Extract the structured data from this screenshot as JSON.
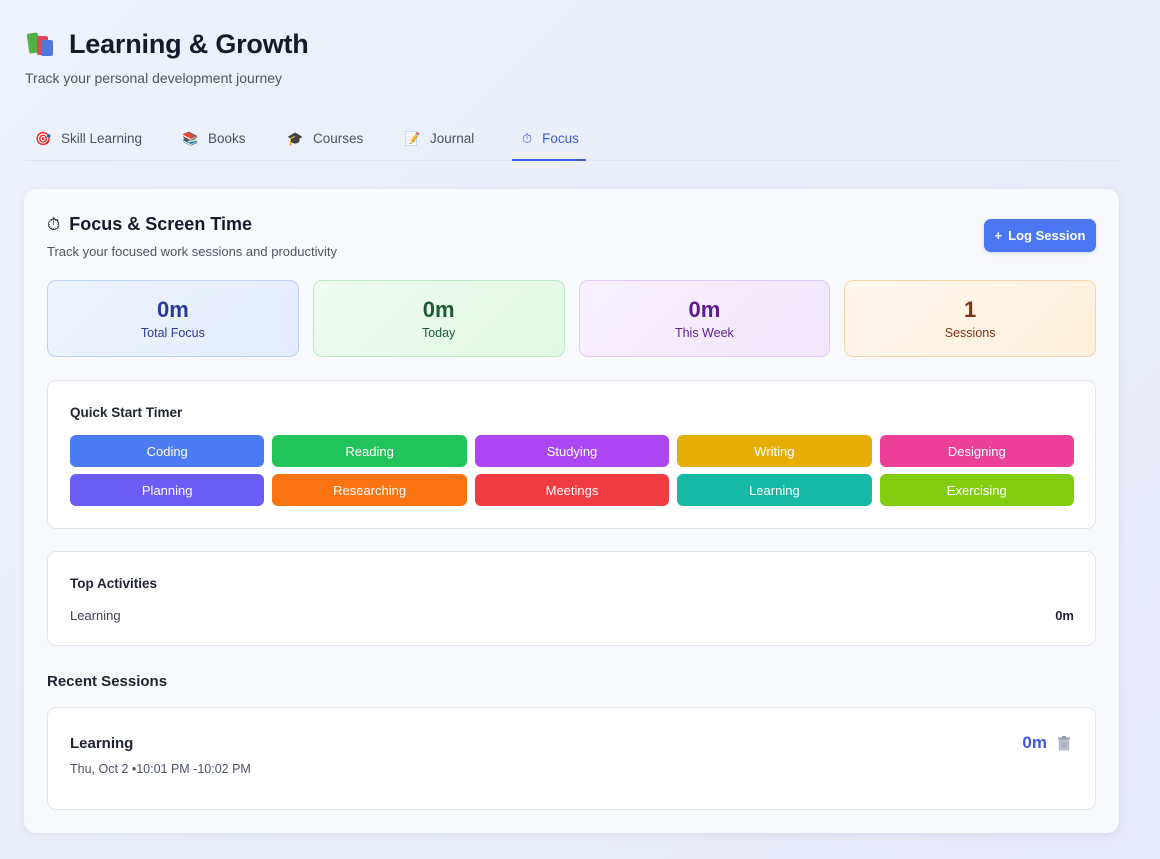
{
  "header": {
    "title": "Learning & Growth",
    "subtitle": "Track your personal development journey",
    "icon": "books-icon"
  },
  "tabs": [
    {
      "label": "Skill Learning",
      "icon": "🎯",
      "active": false
    },
    {
      "label": "Books",
      "icon": "📚",
      "active": false
    },
    {
      "label": "Courses",
      "icon": "🎓",
      "active": false
    },
    {
      "label": "Journal",
      "icon": "📝",
      "active": false
    },
    {
      "label": "Focus",
      "icon": "⏱",
      "active": true
    }
  ],
  "focus": {
    "title": "Focus & Screen Time",
    "title_icon": "⏱",
    "subtitle": "Track your focused work sessions and productivity",
    "log_button": "Log Session",
    "log_button_icon": "+"
  },
  "stats": [
    {
      "value": "0m",
      "label": "Total Focus",
      "color": "#2a3b95"
    },
    {
      "value": "0m",
      "label": "Today",
      "color": "#1d5c33"
    },
    {
      "value": "0m",
      "label": "This Week",
      "color": "#5c1a8c"
    },
    {
      "value": "1",
      "label": "Sessions",
      "color": "#7f3112"
    }
  ],
  "quick_start": {
    "title": "Quick Start Timer",
    "buttons": [
      {
        "label": "Coding",
        "color": "#4b7cf3"
      },
      {
        "label": "Reading",
        "color": "#21c45a"
      },
      {
        "label": "Studying",
        "color": "#ad47f5"
      },
      {
        "label": "Writing",
        "color": "#e6ad06"
      },
      {
        "label": "Designing",
        "color": "#ec3f97"
      },
      {
        "label": "Planning",
        "color": "#6a5cf4"
      },
      {
        "label": "Researching",
        "color": "#f97311"
      },
      {
        "label": "Meetings",
        "color": "#ef3b41"
      },
      {
        "label": "Learning",
        "color": "#16b9a4"
      },
      {
        "label": "Exercising",
        "color": "#82cc12"
      }
    ]
  },
  "top_activities": {
    "title": "Top Activities",
    "items": [
      {
        "name": "Learning",
        "time": "0m"
      }
    ]
  },
  "recent_sessions": {
    "title": "Recent Sessions",
    "items": [
      {
        "name": "Learning",
        "meta": "Thu, Oct 2 •10:01 PM -10:02 PM",
        "duration": "0m"
      }
    ]
  }
}
